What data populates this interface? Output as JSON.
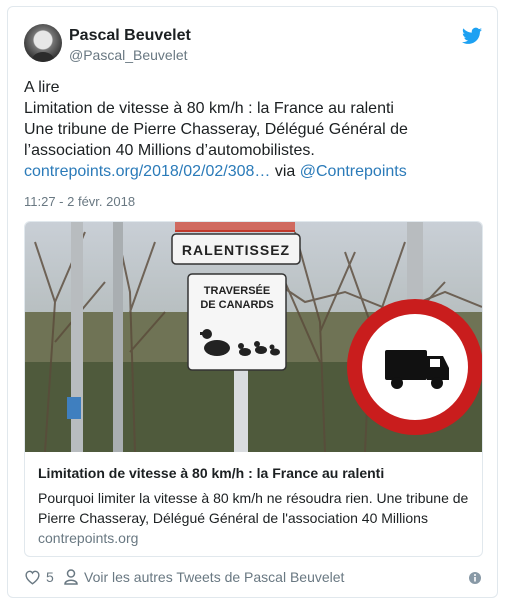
{
  "tweet": {
    "author_name": "Pascal Beuvelet",
    "author_handle": "@Pascal_Beuvelet",
    "line1": "A lire",
    "line2": "Limitation de vitesse à 80 km/h : la France au ralenti",
    "line3_prefix": "Une tribune de Pierre Chasseray, Délégué Général de l’association 40 Millions d’automobilistes. ",
    "link_text": "contrepoints.org/2018/02/02/308…",
    "via_text": " via ",
    "mention": "@Contrepoints",
    "timestamp": "11:27 - 2 févr. 2018"
  },
  "card": {
    "image_sign_top": "RALENTISSEZ",
    "image_sign_line1": "TRAVERSÉE",
    "image_sign_line2": "DE CANARDS",
    "title": "Limitation de vitesse à 80 km/h : la France au ralenti",
    "description": "Pourquoi limiter la vitesse à 80 km/h ne résoudra rien. Une tribune de Pierre Chasseray, Délégué Général de l'association 40 Millions",
    "domain": "contrepoints.org"
  },
  "actions": {
    "like_count": "5",
    "more_tweets_label": "Voir les autres Tweets de Pascal Beuvelet"
  },
  "icons": {
    "twitter_bird": "twitter-bird-icon",
    "heart": "heart-icon",
    "person": "person-icon",
    "info": "info-icon"
  },
  "colors": {
    "link": "#2b7bb9",
    "twitter_blue": "#1da1f2",
    "muted": "#697882",
    "border": "#e1e8ed"
  }
}
